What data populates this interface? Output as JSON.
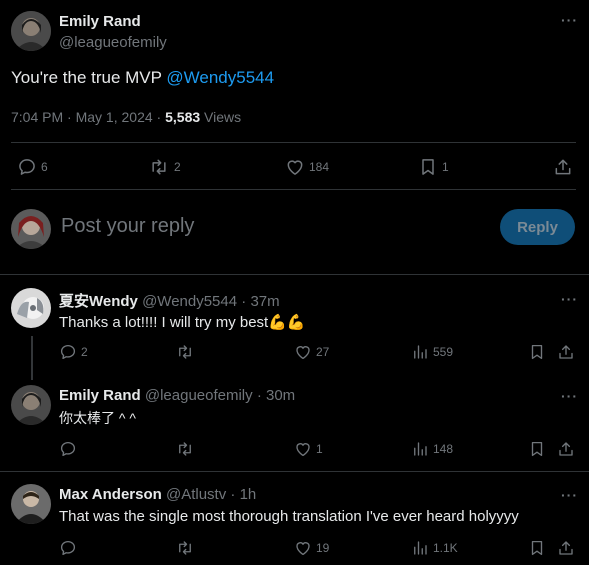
{
  "main_tweet": {
    "author_name": "Emily Rand",
    "author_handle": "@leagueofemily",
    "text_prefix": "You're the true MVP ",
    "mention": "@Wendy5544",
    "time": "7:04 PM",
    "date": "May 1, 2024",
    "views_count": "5,583",
    "views_label": "Views",
    "replies": "6",
    "retweets": "2",
    "likes": "184",
    "bookmarks": "1"
  },
  "composer": {
    "placeholder": "Post your reply",
    "reply_label": "Reply"
  },
  "replies": [
    {
      "name": "夏安Wendy",
      "handle": "@Wendy5544",
      "time": "37m",
      "text": "Thanks a lot!!!! I will try my best",
      "emoji": "💪💪",
      "replies": "2",
      "retweets": "",
      "likes": "27",
      "views": "559"
    },
    {
      "name": "Emily Rand",
      "handle": "@leagueofemily",
      "time": "30m",
      "text": "你太棒了 ^ ^",
      "replies": "",
      "retweets": "",
      "likes": "1",
      "views": "148"
    },
    {
      "name": "Max Anderson",
      "handle": "@Atlustv",
      "time": "1h",
      "text": "That was the single most thorough translation I've ever heard holyyyy",
      "replies": "",
      "retweets": "",
      "likes": "19",
      "views": "1.1K"
    }
  ],
  "separators": {
    "dot": "·"
  },
  "colors": {
    "background": "#000000",
    "text": "#e7e9ea",
    "muted": "#71767b",
    "link": "#1d9bf0",
    "divider": "#2f3336",
    "reply_button": "#0f4e78"
  }
}
